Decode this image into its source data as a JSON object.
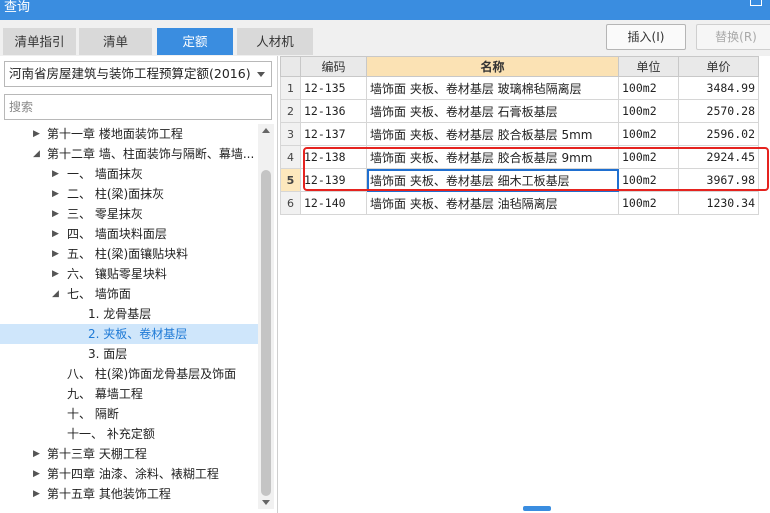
{
  "window": {
    "title": "查询"
  },
  "tabs": [
    {
      "label": "清单指引",
      "active": false
    },
    {
      "label": "清单",
      "active": false
    },
    {
      "label": "定额",
      "active": true
    },
    {
      "label": "人材机",
      "active": false
    }
  ],
  "toolbar": {
    "insert_label": "插入(I)",
    "replace_label": "替换(R)"
  },
  "left": {
    "quota_book": "河南省房屋建筑与装饰工程预算定额(2016)",
    "search_placeholder": "搜索",
    "tree": [
      {
        "text": "第十一章 楼地面装饰工程",
        "state": "collapsed",
        "selected": false
      },
      {
        "text": "第十二章 墙、柱面装饰与隔断、幕墙...",
        "state": "expanded",
        "selected": false
      },
      {
        "text": "一、 墙面抹灰",
        "state": "collapsed",
        "selected": false
      },
      {
        "text": "二、 柱(梁)面抹灰",
        "state": "collapsed",
        "selected": false
      },
      {
        "text": "三、 零星抹灰",
        "state": "collapsed",
        "selected": false
      },
      {
        "text": "四、 墙面块料面层",
        "state": "collapsed",
        "selected": false
      },
      {
        "text": "五、 柱(梁)面镶贴块料",
        "state": "collapsed",
        "selected": false
      },
      {
        "text": "六、 镶贴零星块料",
        "state": "collapsed",
        "selected": false
      },
      {
        "text": "七、 墙饰面",
        "state": "expanded",
        "selected": false
      },
      {
        "text": "1. 龙骨基层",
        "state": "leaf",
        "selected": false
      },
      {
        "text": "2. 夹板、卷材基层",
        "state": "leaf",
        "selected": true
      },
      {
        "text": "3. 面层",
        "state": "leaf",
        "selected": false
      },
      {
        "text": "八、 柱(梁)饰面龙骨基层及饰面",
        "state": "leaf",
        "selected": false
      },
      {
        "text": "九、 幕墙工程",
        "state": "leaf",
        "selected": false
      },
      {
        "text": "十、 隔断",
        "state": "leaf",
        "selected": false
      },
      {
        "text": "十一、 补充定额",
        "state": "leaf",
        "selected": false
      },
      {
        "text": "第十三章 天棚工程",
        "state": "collapsed",
        "selected": false
      },
      {
        "text": "第十四章 油漆、涂料、裱糊工程",
        "state": "collapsed",
        "selected": false
      },
      {
        "text": "第十五章 其他装饰工程",
        "state": "collapsed",
        "selected": false
      }
    ]
  },
  "grid": {
    "columns": [
      "编码",
      "名称",
      "单位",
      "单价"
    ],
    "rows": [
      {
        "no": "1",
        "code": "12-135",
        "name": "墙饰面 夹板、卷材基层 玻璃棉毡隔离层",
        "unit": "100m2",
        "price": "3484.99"
      },
      {
        "no": "2",
        "code": "12-136",
        "name": "墙饰面 夹板、卷材基层 石膏板基层",
        "unit": "100m2",
        "price": "2570.28"
      },
      {
        "no": "3",
        "code": "12-137",
        "name": "墙饰面 夹板、卷材基层 胶合板基层 5mm",
        "unit": "100m2",
        "price": "2596.02"
      },
      {
        "no": "4",
        "code": "12-138",
        "name": "墙饰面 夹板、卷材基层 胶合板基层 9mm",
        "unit": "100m2",
        "price": "2924.45"
      },
      {
        "no": "5",
        "code": "12-139",
        "name": "墙饰面 夹板、卷材基层 细木工板基层",
        "unit": "100m2",
        "price": "3967.98"
      },
      {
        "no": "6",
        "code": "12-140",
        "name": "墙饰面 夹板、卷材基层 油毡隔离层",
        "unit": "100m2",
        "price": "1230.34"
      }
    ],
    "current_row": "5"
  },
  "colors": {
    "accent": "#3a8de0",
    "selection_bg": "#cfe6fb",
    "highlight_border": "#e5231f",
    "header_active": "#fbe2b4"
  }
}
